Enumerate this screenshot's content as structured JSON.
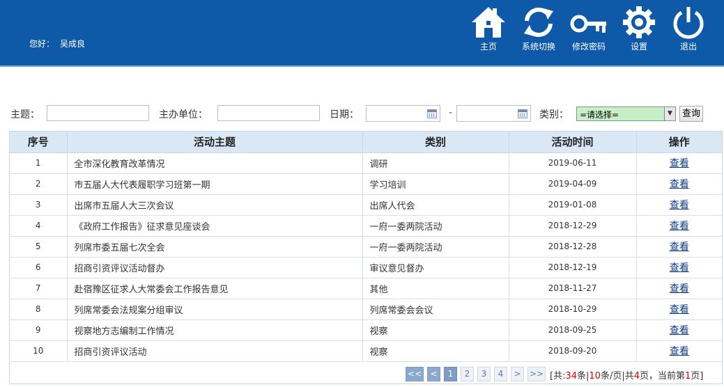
{
  "header": {
    "greeting_label": "您好：",
    "user_name": "吴成良",
    "nav": [
      {
        "label": "主页",
        "icon": "home-icon"
      },
      {
        "label": "系统切换",
        "icon": "refresh-icon"
      },
      {
        "label": "修改密码",
        "icon": "key-icon"
      },
      {
        "label": "设置",
        "icon": "gear-icon"
      },
      {
        "label": "退出",
        "icon": "power-icon"
      }
    ],
    "colors": {
      "bar": "#0f5aa8",
      "accent_line": "#6fa6d8"
    }
  },
  "filter": {
    "subject_label": "主题：",
    "subject_value": "",
    "org_label": "主办单位：",
    "org_value": "",
    "date_label": "日期：",
    "date_from": "",
    "date_sep": "-",
    "date_to": "",
    "category_label": "类别：",
    "category_selected": "=请选择=",
    "query_button": "查询"
  },
  "table": {
    "headers": [
      "序号",
      "活动主题",
      "类别",
      "活动时间",
      "操作"
    ],
    "rows": [
      {
        "idx": "1",
        "title": "全市深化教育改革情况",
        "category": "调研",
        "date": "2019-06-11",
        "op": "查看"
      },
      {
        "idx": "2",
        "title": "市五届人大代表履职学习班第一期",
        "category": "学习培训",
        "date": "2019-04-09",
        "op": "查看"
      },
      {
        "idx": "3",
        "title": "出席市五届人大三次会议",
        "category": "出席人代会",
        "date": "2019-01-08",
        "op": "查看"
      },
      {
        "idx": "4",
        "title": "《政府工作报告》征求意见座谈会",
        "category": "一府一委两院活动",
        "date": "2018-12-29",
        "op": "查看"
      },
      {
        "idx": "5",
        "title": "列席市委五届七次全会",
        "category": "一府一委两院活动",
        "date": "2018-12-28",
        "op": "查看"
      },
      {
        "idx": "6",
        "title": "招商引资评议活动督办",
        "category": "审议意见督办",
        "date": "2018-12-19",
        "op": "查看"
      },
      {
        "idx": "7",
        "title": "赴宿豫区征求人大常委会工作报告意见",
        "category": "其他",
        "date": "2018-11-27",
        "op": "查看"
      },
      {
        "idx": "8",
        "title": "列席常委会法规案分组审议",
        "category": "列席常委会会议",
        "date": "2018-10-29",
        "op": "查看"
      },
      {
        "idx": "9",
        "title": "视察地方志编制工作情况",
        "category": "视察",
        "date": "2018-09-25",
        "op": "查看"
      },
      {
        "idx": "10",
        "title": "招商引资评议活动",
        "category": "视察",
        "date": "2018-09-20",
        "op": "查看"
      }
    ]
  },
  "pager": {
    "first": "<<",
    "prev": "<",
    "pages": [
      "1",
      "2",
      "3",
      "4"
    ],
    "current": "1",
    "next": ">",
    "last": ">>",
    "info": {
      "prefix": "[共:",
      "total": "34",
      "mid1": "条|",
      "per_page": "10",
      "mid2": "条/页|共",
      "total_pages": "4",
      "mid3": "页，当前第",
      "current_page": "1",
      "suffix": "页]"
    }
  }
}
